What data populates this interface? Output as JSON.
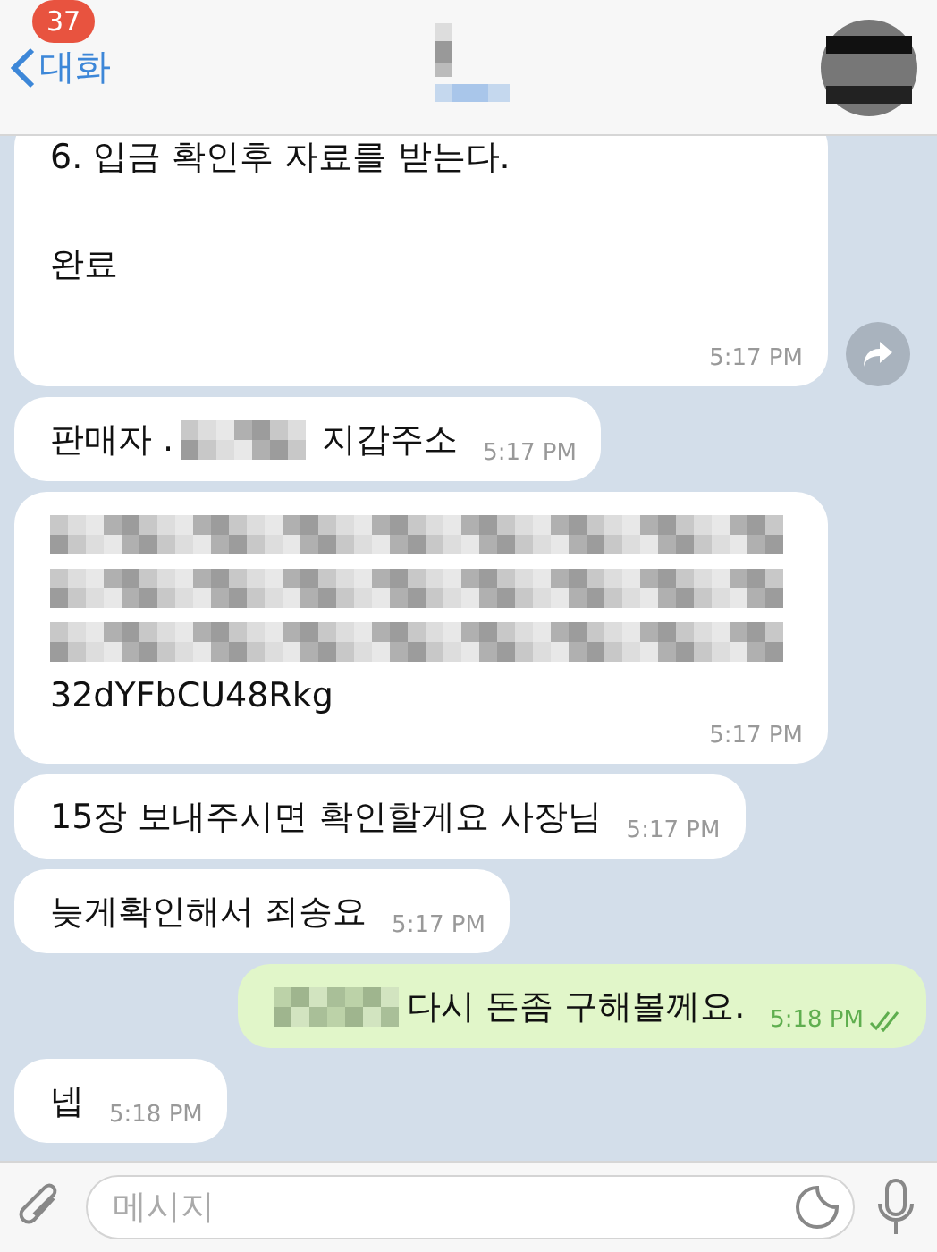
{
  "header": {
    "back_label": "대화",
    "unread_count": "37"
  },
  "messages": [
    {
      "outgoing": false,
      "forward": true,
      "lines": [
        {
          "kind": "content",
          "segments": [
            {
              "kind": "text",
              "text": "6. 입금 확인후 자료를 받는다."
            }
          ]
        },
        {
          "kind": "spacer"
        },
        {
          "kind": "content",
          "segments": [
            {
              "kind": "text",
              "text": "완료"
            }
          ]
        },
        {
          "kind": "spacer"
        }
      ],
      "time": "5:17 PM"
    },
    {
      "outgoing": false,
      "forward": false,
      "lines": [
        {
          "kind": "content",
          "segments": [
            {
              "kind": "text",
              "text": "판매자 ."
            },
            {
              "kind": "blur"
            },
            {
              "kind": "text",
              "text": "지갑주소"
            }
          ]
        }
      ],
      "time": "5:17 PM"
    },
    {
      "outgoing": false,
      "forward": false,
      "lines": [
        {
          "kind": "content",
          "segments": [
            {
              "kind": "blur_line"
            }
          ]
        },
        {
          "kind": "content",
          "segments": [
            {
              "kind": "blur_line"
            }
          ]
        },
        {
          "kind": "content",
          "segments": [
            {
              "kind": "blur_line"
            }
          ]
        },
        {
          "kind": "content",
          "segments": [
            {
              "kind": "text",
              "text": "32dYFbCU48Rkg"
            }
          ]
        }
      ],
      "time": "5:17 PM"
    },
    {
      "outgoing": false,
      "forward": false,
      "lines": [
        {
          "kind": "content",
          "segments": [
            {
              "kind": "text",
              "text": "15장 보내주시면 확인할게요 사장님"
            }
          ]
        }
      ],
      "time": "5:17 PM"
    },
    {
      "outgoing": false,
      "forward": false,
      "lines": [
        {
          "kind": "content",
          "segments": [
            {
              "kind": "text",
              "text": "늦게확인해서 죄송요"
            }
          ]
        }
      ],
      "time": "5:17 PM"
    },
    {
      "outgoing": true,
      "forward": false,
      "read": true,
      "lines": [
        {
          "kind": "content",
          "segments": [
            {
              "kind": "blur"
            },
            {
              "kind": "text",
              "text": "다시 돈좀 구해볼께요."
            }
          ]
        }
      ],
      "time": "5:18 PM"
    },
    {
      "outgoing": false,
      "forward": false,
      "lines": [
        {
          "kind": "content",
          "segments": [
            {
              "kind": "text",
              "text": "넵"
            }
          ]
        }
      ],
      "time": "5:18 PM"
    }
  ],
  "composer": {
    "placeholder": "메시지"
  }
}
